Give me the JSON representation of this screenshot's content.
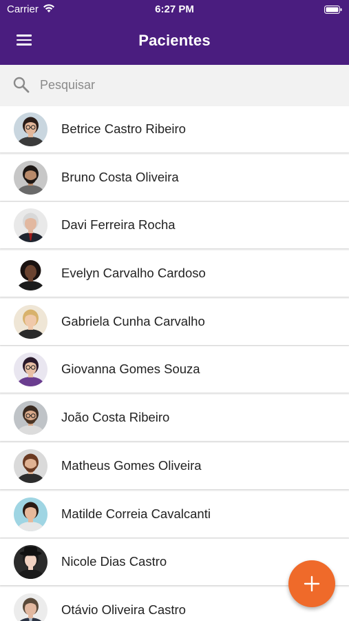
{
  "status_bar": {
    "carrier": "Carrier",
    "time": "6:27 PM"
  },
  "header": {
    "title": "Pacientes",
    "menu_icon": "menu-icon"
  },
  "search": {
    "placeholder": "Pesquisar",
    "value": "",
    "icon": "search-icon"
  },
  "colors": {
    "header": "#4a1d7f",
    "fab": "#ef6a2a",
    "background": "#f2f2f2"
  },
  "patients": [
    {
      "name": "Betrice Castro Ribeiro",
      "avatar": "woman-glasses"
    },
    {
      "name": "Bruno Costa Oliveira",
      "avatar": "man-beard"
    },
    {
      "name": "Davi Ferreira Rocha",
      "avatar": "older-man-suit"
    },
    {
      "name": "Evelyn Carvalho Cardoso",
      "avatar": "woman-curly-hair"
    },
    {
      "name": "Gabriela Cunha Carvalho",
      "avatar": "woman-blonde"
    },
    {
      "name": "Giovanna Gomes Souza",
      "avatar": "woman-glasses-dark-hair"
    },
    {
      "name": "João Costa Ribeiro",
      "avatar": "man-glasses-beard"
    },
    {
      "name": "Matheus Gomes Oliveira",
      "avatar": "man-beard-red"
    },
    {
      "name": "Matilde Correia Cavalcanti",
      "avatar": "woman-smiling"
    },
    {
      "name": "Nicole Dias Castro",
      "avatar": "woman-hat"
    },
    {
      "name": "Otávio Oliveira Castro",
      "avatar": "man-suit"
    }
  ],
  "fab": {
    "icon": "plus-icon",
    "action": "add patient"
  }
}
